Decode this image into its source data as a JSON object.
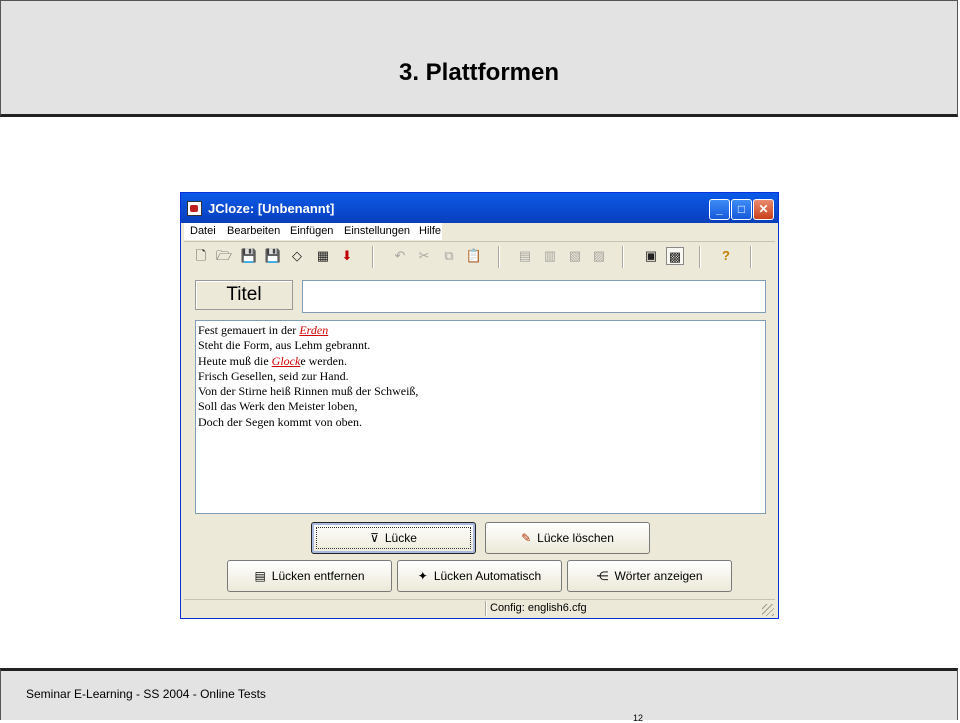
{
  "slide": {
    "title": "3. Plattformen",
    "footer": "Seminar E-Learning  - SS 2004  - Online Tests",
    "page_number": "12"
  },
  "window": {
    "title": "JCloze: [Unbenannt]",
    "controls": {
      "minimize": "_",
      "maximize": "□",
      "close": "✕"
    }
  },
  "menu": [
    "Datei",
    "Bearbeiten",
    "Einfügen",
    "Einstellungen",
    "Hilfe"
  ],
  "toolbar": {
    "icons": [
      "new-file-icon",
      "open-folder-icon",
      "save-icon",
      "save-as-icon",
      "erase-icon",
      "web-export-icon",
      "arrow-down-icon",
      "undo-icon",
      "cut-icon",
      "copy-icon",
      "paste-icon",
      "gap-icon",
      "gap-delete-icon",
      "gap-auto-icon",
      "word-list-icon",
      "view-icon",
      "settings-icon",
      "help-icon"
    ]
  },
  "titel": {
    "label": "Titel",
    "value": ""
  },
  "text": {
    "lines": [
      {
        "before": "Fest gemauert in der ",
        "gap": "Erden",
        "after": ""
      },
      {
        "before": "Steht die Form, aus Lehm gebrannt.",
        "gap": "",
        "after": ""
      },
      {
        "before": "Heute muß die ",
        "gap": "Glock",
        "after": "e werden."
      },
      {
        "before": "Frisch Gesellen, seid zur Hand.",
        "gap": "",
        "after": ""
      },
      {
        "before": "Von der Stirne heiß Rinnen muß der Schweiß,",
        "gap": "",
        "after": ""
      },
      {
        "before": "Soll das Werk den Meister loben,",
        "gap": "",
        "after": ""
      },
      {
        "before": "Doch der Segen kommt von oben.",
        "gap": "",
        "after": ""
      }
    ]
  },
  "buttons": {
    "luecke": "Lücke",
    "luecke_loeschen": "Lücke löschen",
    "luecken_entfernen": "Lücken entfernen",
    "luecken_automatisch": "Lücken Automatisch",
    "woerter_anzeigen": "Wörter anzeigen"
  },
  "status": {
    "left": "",
    "config": "Config: english6.cfg"
  }
}
